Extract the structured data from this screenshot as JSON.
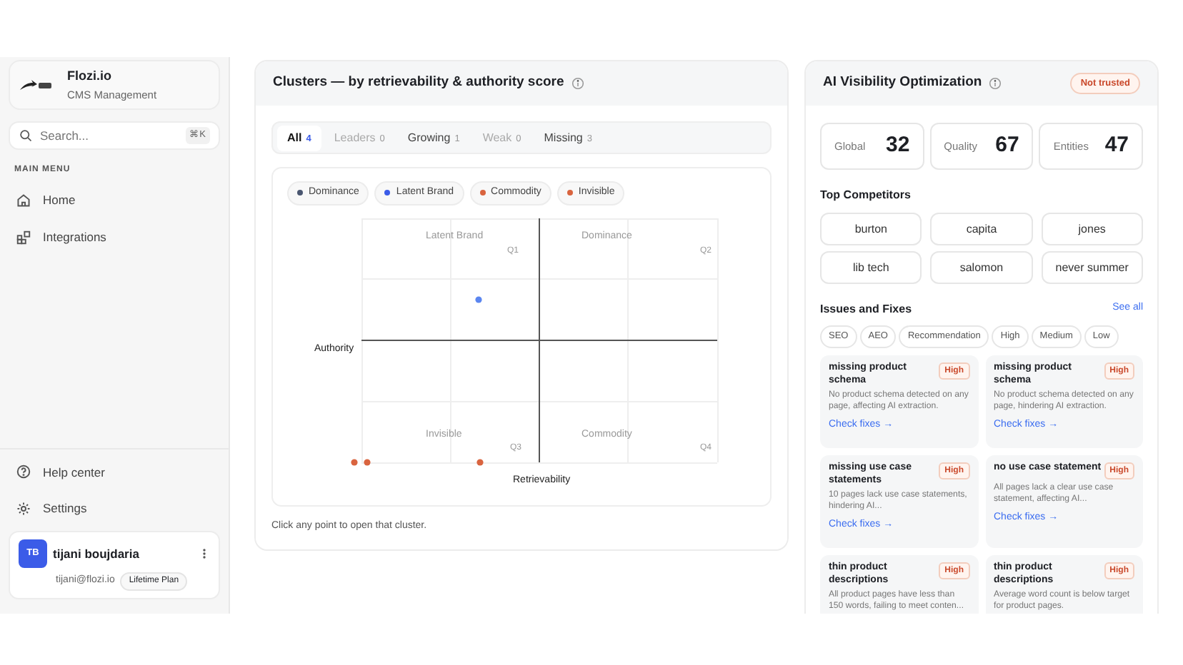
{
  "sidebar": {
    "brand": {
      "name": "Flozi.io",
      "subtitle": "CMS Management"
    },
    "search": {
      "placeholder": "Search...",
      "shortcut": "⌘K"
    },
    "section_label": "MAIN MENU",
    "items": [
      {
        "label": "Home"
      },
      {
        "label": "Integrations"
      }
    ],
    "bottom_items": [
      {
        "label": "Help center"
      },
      {
        "label": "Settings"
      }
    ],
    "user": {
      "initials": "TB",
      "name": "tijani boujdaria",
      "email": "tijani@flozi.io",
      "plan": "Lifetime Plan"
    }
  },
  "clusters": {
    "title": "Clusters — by retrievability & authority score",
    "tabs": [
      {
        "label": "All",
        "count": "4",
        "selected": true
      },
      {
        "label": "Leaders",
        "count": "0",
        "selected": false,
        "empty": true
      },
      {
        "label": "Growing",
        "count": "1",
        "selected": false,
        "empty": false
      },
      {
        "label": "Weak",
        "count": "0",
        "selected": false,
        "empty": true
      },
      {
        "label": "Missing",
        "count": "3",
        "selected": false,
        "empty": false
      }
    ],
    "legend": [
      {
        "label": "Dominance",
        "color": "#4a5670"
      },
      {
        "label": "Latent Brand",
        "color": "#3b5ce8"
      },
      {
        "label": "Commodity",
        "color": "#d9643f"
      },
      {
        "label": "Invisible",
        "color": "#d9643f"
      }
    ],
    "quadrants": [
      {
        "name": "Latent Brand",
        "code": "Q1"
      },
      {
        "name": "Dominance",
        "code": "Q2"
      },
      {
        "name": "Invisible",
        "code": "Q3"
      },
      {
        "name": "Commodity",
        "code": "Q4"
      }
    ],
    "ylabel": "Authority",
    "xlabel": "Retrievability",
    "footnote": "Click any point to open that cluster."
  },
  "visibility": {
    "title": "AI Visibility Optimization",
    "badge": "Not trusted",
    "stats": [
      {
        "label": "Global",
        "value": "32"
      },
      {
        "label": "Quality",
        "value": "67"
      },
      {
        "label": "Entities",
        "value": "47"
      }
    ],
    "competitors_title": "Top Competitors",
    "competitors": [
      "burton",
      "capita",
      "jones",
      "lib tech",
      "salomon",
      "never summer"
    ],
    "issues_title": "Issues and Fixes",
    "see_all": "See all",
    "filters": [
      "SEO",
      "AEO",
      "Recommendation",
      "High",
      "Medium",
      "Low"
    ],
    "issues": [
      {
        "title": "missing product schema",
        "severity": "High",
        "description": "No product schema detected on any page, affecting AI extraction.",
        "action": "Check fixes →"
      },
      {
        "title": "missing product schema",
        "severity": "High",
        "description": "No product schema detected on any page, hindering AI extraction.",
        "action": "Check fixes →"
      },
      {
        "title": "missing use case statements",
        "severity": "High",
        "description": "10 pages lack use case statements, hindering AI...",
        "action": "Check fixes →"
      },
      {
        "title": "no use case statement",
        "severity": "High",
        "description": "All pages lack a clear use case statement, affecting AI...",
        "action": "Check fixes →"
      },
      {
        "title": "thin product descriptions",
        "severity": "High",
        "description": "All product pages have less than 150 words, failing to meet conten..."
      },
      {
        "title": "thin product descriptions",
        "severity": "High",
        "description": "Average word count is below target for product pages."
      }
    ]
  }
}
